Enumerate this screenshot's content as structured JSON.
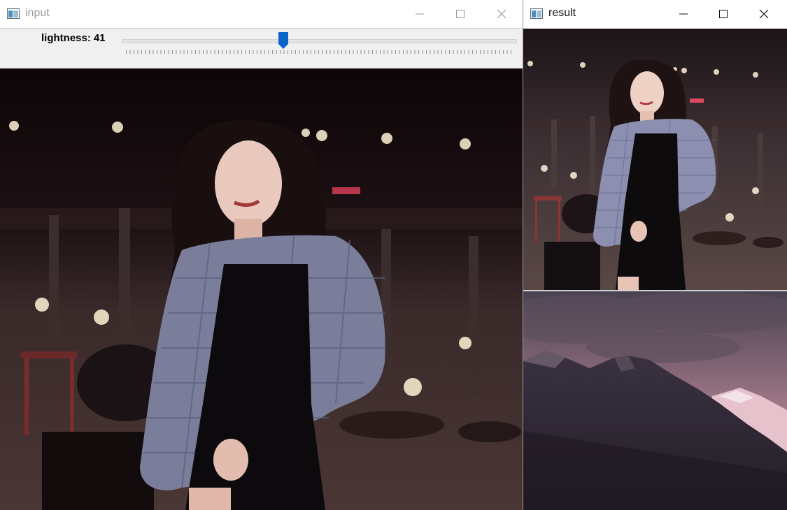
{
  "input_window": {
    "title": "input",
    "icon": "opencv-window-icon",
    "controls": [
      "minimize-icon",
      "maximize-icon",
      "close-icon"
    ],
    "trackbar": {
      "label": "lightness:",
      "value": "41",
      "position_fraction": 0.41
    }
  },
  "result_window": {
    "title": "result",
    "icon": "opencv-window-icon",
    "controls": [
      "minimize-icon",
      "maximize-icon",
      "close-icon"
    ]
  },
  "images": {
    "input": "photo-woman-night-rooftop",
    "result_top": "photo-woman-night-rooftop-adjusted",
    "result_bottom": "photo-mountain-pink-sky"
  },
  "colors": {
    "slider_thumb": "#0a64c8",
    "toolbar_bg": "#f0f0f0"
  }
}
